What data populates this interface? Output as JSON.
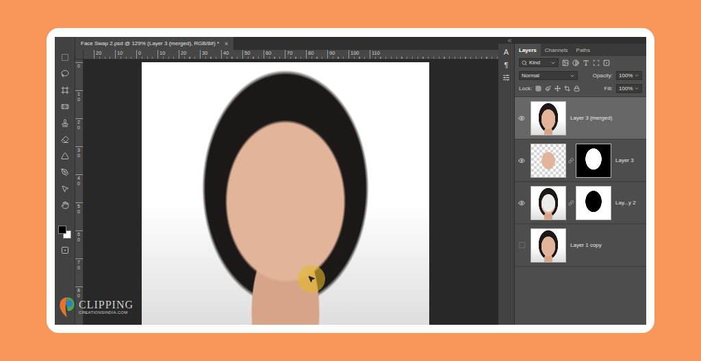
{
  "window": {
    "title": "Face Swap 2.psd @ 129% (Layer 3 (merged), RGB/8#) *",
    "close": "×"
  },
  "ruler": {
    "horizontal": [
      "20",
      "10",
      "0",
      "10",
      "20",
      "30",
      "40",
      "50",
      "60",
      "70",
      "80",
      "90",
      "100",
      "110"
    ],
    "vertical": [
      "0",
      "10",
      "20",
      "30",
      "40",
      "50",
      "60",
      "70",
      "80"
    ]
  },
  "watermark": {
    "name": "CLIPPING",
    "url": "CREATIONSINDIA.COM"
  },
  "side_tools": [
    "A",
    "¶"
  ],
  "panel": {
    "tabs": [
      {
        "label": "Layers",
        "selected": true
      },
      {
        "label": "Channels",
        "selected": false
      },
      {
        "label": "Paths",
        "selected": false
      }
    ],
    "filter": "Kind",
    "blend_mode": "Normal",
    "opacity": {
      "label": "Opacity:",
      "value": "100%"
    },
    "lock": "Lock:",
    "fill": {
      "label": "Fill:",
      "value": "100%"
    }
  },
  "layers": [
    {
      "name": "Layer 3 (merged)",
      "visible": true,
      "selected": true,
      "kind": "plain"
    },
    {
      "name": "Layer 3",
      "visible": true,
      "selected": false,
      "kind": "masked-face"
    },
    {
      "name": "Lay...y 2",
      "visible": true,
      "selected": false,
      "kind": "masked-hole"
    },
    {
      "name": "Layer 1 copy",
      "visible": false,
      "selected": false,
      "kind": "plain"
    }
  ]
}
